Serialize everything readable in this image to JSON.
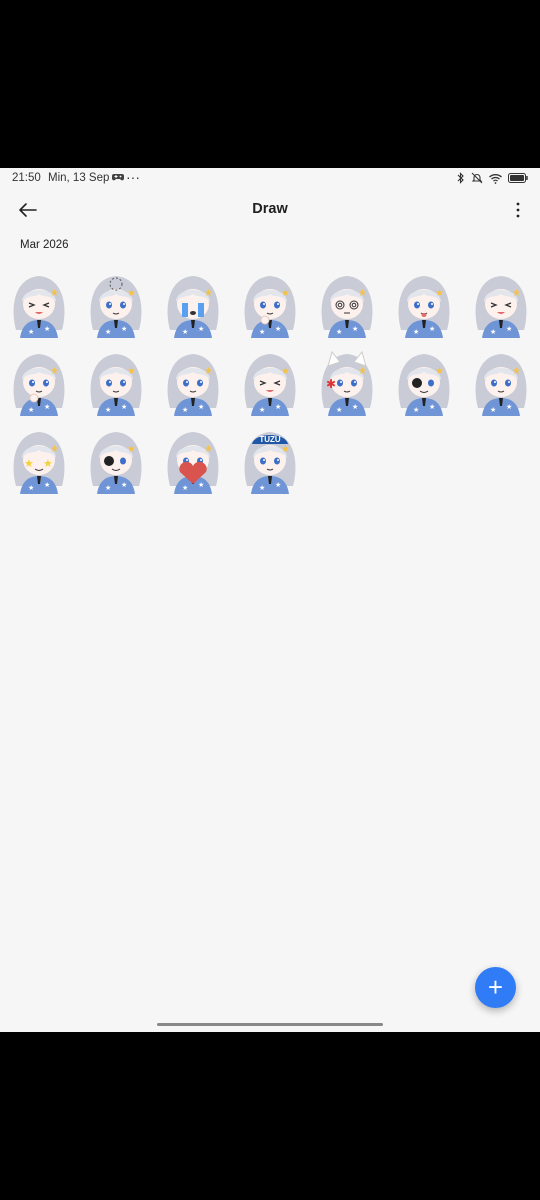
{
  "status_bar": {
    "time": "21:50",
    "date": "Min, 13 Sep",
    "dots": "···"
  },
  "app_bar": {
    "title": "Draw"
  },
  "gallery": {
    "section_label": "Mar 2026",
    "items": [
      {
        "name": "sticker-laughing",
        "caption": ""
      },
      {
        "name": "sticker-loading",
        "caption": ""
      },
      {
        "name": "sticker-crying",
        "caption": ""
      },
      {
        "name": "sticker-thumbs-up",
        "caption": ""
      },
      {
        "name": "sticker-dizzy",
        "caption": ""
      },
      {
        "name": "sticker-tongue-out",
        "caption": ""
      },
      {
        "name": "sticker-squint-laugh",
        "caption": ""
      },
      {
        "name": "sticker-flower",
        "caption": ""
      },
      {
        "name": "sticker-pout",
        "caption": ""
      },
      {
        "name": "sticker-shy",
        "caption": ""
      },
      {
        "name": "sticker-wink",
        "caption": ""
      },
      {
        "name": "sticker-angry-cat",
        "caption": ""
      },
      {
        "name": "sticker-eyepatch-shout",
        "caption": ""
      },
      {
        "name": "sticker-closeup",
        "caption": ""
      },
      {
        "name": "sticker-star-eyes",
        "caption": ""
      },
      {
        "name": "sticker-eyepatch",
        "caption": ""
      },
      {
        "name": "sticker-heart",
        "caption": ""
      },
      {
        "name": "sticker-tuzu-hat",
        "caption": "TUZU"
      }
    ]
  },
  "fab": {
    "icon": "plus-icon",
    "label": "+"
  },
  "colors": {
    "background": "#f6f6f6",
    "accent": "#2f7cf6",
    "hair": "#c9ccd6",
    "outfit": "#6f95d6"
  }
}
